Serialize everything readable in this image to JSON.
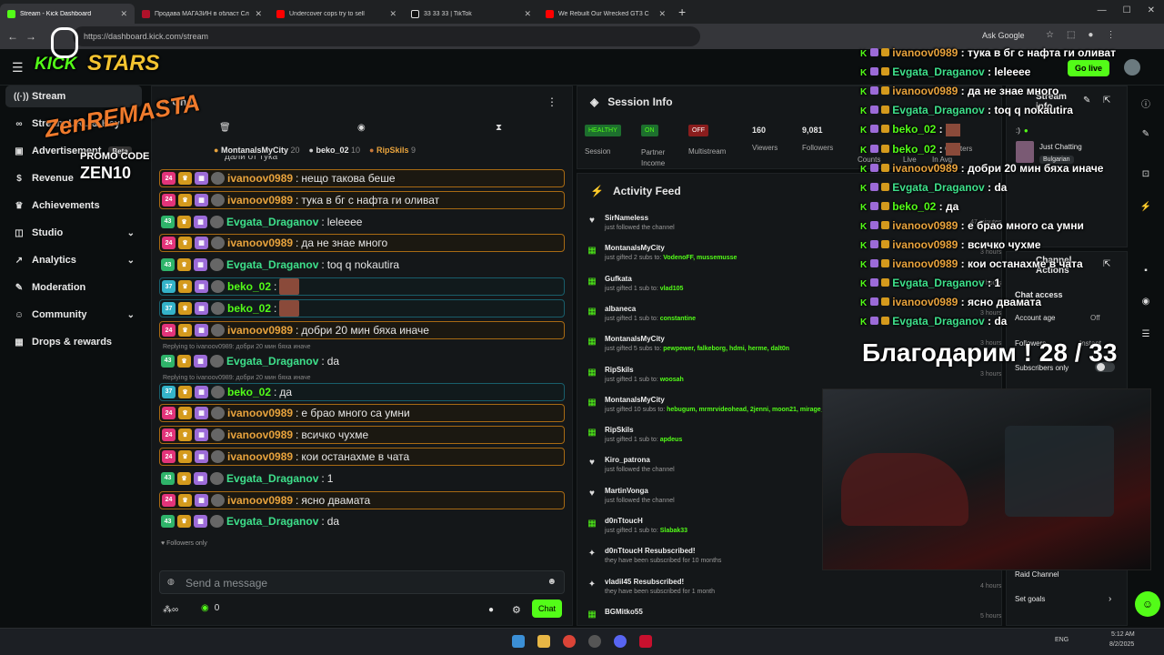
{
  "colors": {
    "accent": "#53fc18",
    "gold": "#e8a33d",
    "pink": "#e2347a",
    "mint": "#3ee08b"
  },
  "browser": {
    "tabs": [
      {
        "title": "Stream - Kick Dashboard"
      },
      {
        "title": "Продава МАГАЗИН в област Сл"
      },
      {
        "title": "Undercover cops try to sell"
      },
      {
        "title": "33 33 33 | TikTok"
      },
      {
        "title": "We Rebuilt Our Wrecked GT3 C"
      }
    ],
    "new_tab": "+",
    "url": "https://dashboard.kick.com/stream",
    "ask_google": "Ask Google"
  },
  "overlay": {
    "logo_a": "KICK",
    "logo_b": "STARS",
    "brand": "ZenREMASTA",
    "promo_label": "PROMO CODE",
    "promo_code": "ZEN10",
    "thanks": "Благодарим ! 28 / 33"
  },
  "header": {
    "go_live": "Go live"
  },
  "sidebar": {
    "items": [
      {
        "label": "Stream",
        "icon": "broadcast-icon"
      },
      {
        "label": "Stream URL & Key",
        "icon": "link-icon"
      },
      {
        "label": "Advertisement",
        "icon": "ad-icon",
        "badge": "Beta"
      },
      {
        "label": "Revenue",
        "icon": "dollar-icon"
      },
      {
        "label": "Achievements",
        "icon": "trophy-icon"
      },
      {
        "label": "Studio",
        "icon": "studio-icon"
      },
      {
        "label": "Analytics",
        "icon": "chart-icon"
      },
      {
        "label": "Moderation",
        "icon": "wrench-icon"
      },
      {
        "label": "Community",
        "icon": "people-icon"
      },
      {
        "label": "Drops & rewards",
        "icon": "gift-icon"
      }
    ]
  },
  "chat": {
    "title": "Chat",
    "top_gifters": [
      {
        "name": "MontanalsMyCity",
        "count": "20"
      },
      {
        "name": "beko_02",
        "count": "10"
      },
      {
        "name": "RipSkils",
        "count": "9"
      }
    ],
    "cut_text": "дали от тука",
    "messages": [
      {
        "user": "ivanoov0989",
        "text": "нещо такова беше",
        "badge": "24"
      },
      {
        "user": "ivanoov0989",
        "text": "тука в бг с нафта ги оливат",
        "badge": "24"
      },
      {
        "user": "Evgata_Draganov",
        "text": "leleeee",
        "badge": "43"
      },
      {
        "user": "ivanoov0989",
        "text": "да не знае много",
        "badge": "24"
      },
      {
        "user": "Evgata_Draganov",
        "text": "toq q nokautira",
        "badge": "43"
      },
      {
        "user": "beko_02",
        "text": "",
        "badge": "37"
      },
      {
        "user": "beko_02",
        "text": "",
        "badge": "37"
      },
      {
        "user": "ivanoov0989",
        "text": "добри 20 мин бяха иначе",
        "badge": "24"
      },
      {
        "user": "Evgata_Draganov",
        "text": "da",
        "badge": "43",
        "reply": "Replying to ivanoov0989: добри 20 мин бяха иначе"
      },
      {
        "user": "beko_02",
        "text": "да",
        "badge": "37",
        "reply": "Replying to ivanoov0989: добри 20 мин бяха иначе"
      },
      {
        "user": "ivanoov0989",
        "text": "е брао много са умни",
        "badge": "24"
      },
      {
        "user": "ivanoov0989",
        "text": "всичко чухме",
        "badge": "24"
      },
      {
        "user": "ivanoov0989",
        "text": "кои останахме в чата",
        "badge": "24"
      },
      {
        "user": "Evgata_Draganov",
        "text": "1",
        "badge": "43"
      },
      {
        "user": "ivanoov0989",
        "text": "ясно двамата",
        "badge": "24"
      },
      {
        "user": "Evgata_Draganov",
        "text": "da",
        "badge": "43"
      }
    ],
    "followers_only": "Followers only",
    "emote_label": "WHO ASKED",
    "placeholder": "Send a message",
    "points": "0",
    "send_label": "Chat"
  },
  "session": {
    "title": "Session Info",
    "session_state": "HEALTHY",
    "session_label": "Session",
    "partner_state": "ON",
    "partner_label1": "Partner",
    "partner_label2": "Income",
    "multistream_state": "OFF",
    "multistream_label": "Multistream",
    "viewers": "160",
    "viewers_label": "Viewers",
    "followers": "9,081",
    "followers_label": "Followers",
    "counts_label": "Counts",
    "live_label": "Live",
    "chatters_label": "Chatters",
    "in_avg_label": "In Avg"
  },
  "activity": {
    "title": "Activity Feed",
    "items": [
      {
        "name": "SirNameless",
        "desc": "just followed the channel",
        "time": "47 minutes ago",
        "icon": "heart-icon"
      },
      {
        "name": "MontanalsMyCity",
        "desc": "just gifted 2 subs to:",
        "users": "VodenoFF, mussemusse",
        "time": "3 hours ago",
        "icon": "gift-icon"
      },
      {
        "name": "Gufkata",
        "desc": "just gifted 1 sub to:",
        "users": "vlad105",
        "time": "3 hours ago",
        "icon": "gift-icon"
      },
      {
        "name": "albaneca",
        "desc": "just gifted 1 sub to:",
        "users": "constantine",
        "time": "3 hours ago",
        "icon": "gift-icon"
      },
      {
        "name": "MontanalsMyCity",
        "desc": "just gifted 5 subs to:",
        "users": "pewpewer, falkeborg, hdmi, herme, dalt0n",
        "time": "3 hours ago",
        "icon": "gift-icon"
      },
      {
        "name": "RipSkils",
        "desc": "just gifted 1 sub to:",
        "users": "woosah",
        "time": "3 hours ago",
        "icon": "gift-icon"
      },
      {
        "name": "MontanalsMyCity",
        "desc": "just gifted 10 subs to:",
        "users": "hebugum, mrmrvideohead, 2jenni, moon21, mirage_edge, schizop",
        "time": "3 hours ago",
        "icon": "gift-icon"
      },
      {
        "name": "RipSkils",
        "desc": "just gifted 1 sub to:",
        "users": "apdeus",
        "time": "3 hours ago",
        "icon": "gift-icon"
      },
      {
        "name": "Kiro_patrona",
        "desc": "just followed the channel",
        "time": "3 hours ago",
        "icon": "heart-icon"
      },
      {
        "name": "MartinVonga",
        "desc": "just followed the channel",
        "time": "3 hours ago",
        "icon": "heart-icon"
      },
      {
        "name": "d0nTtoucH",
        "desc": "just gifted 1 sub to:",
        "users": "Slabak33",
        "time": "4 hours ago",
        "icon": "gift-icon"
      },
      {
        "name": "d0nTtoucH Resubscribed!",
        "desc": "they have been subscribed for 10 months",
        "time": "4 hours ago",
        "icon": "sparkle-icon"
      },
      {
        "name": "vladil45 Resubscribed!",
        "desc": "they have been subscribed for 1 month",
        "time": "4 hours ago",
        "icon": "sparkle-icon"
      },
      {
        "name": "BGMitko55",
        "desc": "",
        "time": "5 hours ago",
        "icon": "gift-icon"
      }
    ]
  },
  "stream_info": {
    "title": "Stream info",
    "emote": ":)",
    "category": "Just Chatting",
    "language": "Bulgarian"
  },
  "channel_actions": {
    "title": "Channel Actions",
    "chat_access": "Chat access",
    "account_age": "Account age",
    "account_age_value": "Off",
    "followers": "Followers",
    "followers_value": "Instant",
    "subscribers_only": "Subscribers only",
    "raid": "Raid Channel",
    "goals": "Set goals"
  },
  "right_chat": [
    {
      "user": "ivanoov0989",
      "text": "тука в бг с нафта ги оливат"
    },
    {
      "user": "Evgata_Draganov",
      "text": "leleeee"
    },
    {
      "user": "ivanoov0989",
      "text": "да не знае много"
    },
    {
      "user": "Evgata_Draganov",
      "text": "toq q nokautira"
    },
    {
      "user": "beko_02",
      "text": ""
    },
    {
      "user": "beko_02",
      "text": ""
    },
    {
      "user": "ivanoov0989",
      "text": "добри 20 мин бяха иначе"
    },
    {
      "user": "Evgata_Draganov",
      "text": "da"
    },
    {
      "user": "beko_02",
      "text": "да"
    },
    {
      "user": "ivanoov0989",
      "text": "е брао много са умни"
    },
    {
      "user": "ivanoov0989",
      "text": "всичко чухме"
    },
    {
      "user": "ivanoov0989",
      "text": "кои останахме в чата"
    },
    {
      "user": "Evgata_Draganov",
      "text": "1"
    },
    {
      "user": "ivanoov0989",
      "text": "ясно двамата"
    },
    {
      "user": "Evgata_Draganov",
      "text": "da"
    }
  ],
  "taskbar": {
    "lang": "ENG",
    "time": "5:12 AM",
    "date": "8/2/2025"
  }
}
